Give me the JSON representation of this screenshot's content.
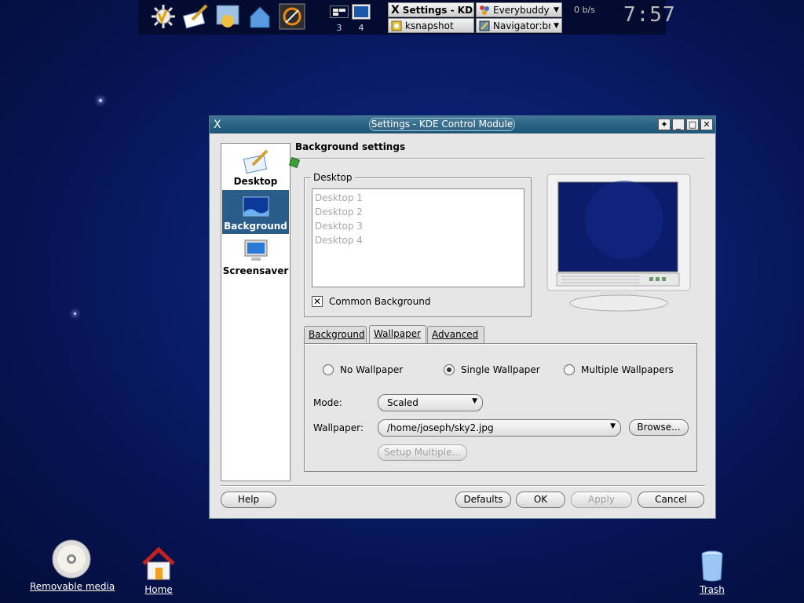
{
  "taskbar": {
    "pager": {
      "desk3": "3",
      "desk4": "4"
    },
    "tasks": [
      {
        "label": "Settings - KDE Control Module"
      },
      {
        "label": "Everybuddy"
      },
      {
        "label": "ksnapshot"
      },
      {
        "label": "Navigator:browser"
      }
    ],
    "net_speed": "0 b/s",
    "clock": "7:57"
  },
  "desktop_icons": {
    "removable": "Removable media",
    "home": "Home",
    "trash": "Trash"
  },
  "window": {
    "title": "Settings - KDE Control Module",
    "sidebar": {
      "items": [
        {
          "label": "Desktop"
        },
        {
          "label": "Background"
        },
        {
          "label": "Screensaver"
        }
      ]
    },
    "heading": "Background settings",
    "desktop_group": {
      "title": "Desktop",
      "items": [
        "Desktop 1",
        "Desktop 2",
        "Desktop 3",
        "Desktop 4"
      ],
      "common_background_label": "Common Background",
      "common_background_checked": true
    },
    "tabs": [
      "Background",
      "Wallpaper",
      "Advanced"
    ],
    "wallpaper": {
      "no_wallpaper": "No Wallpaper",
      "single_wallpaper": "Single Wallpaper",
      "multiple_wallpapers": "Multiple Wallpapers",
      "mode_label": "Mode:",
      "mode_value": "Scaled",
      "wallpaper_label": "Wallpaper:",
      "wallpaper_value": "/home/joseph/sky2.jpg",
      "browse": "Browse...",
      "setup_multiple": "Setup Multiple..."
    },
    "buttons": {
      "help": "Help",
      "defaults": "Defaults",
      "ok": "OK",
      "apply": "Apply",
      "cancel": "Cancel"
    }
  },
  "colors": {
    "selection": "#2a5c89",
    "titlebar": "#2a6283",
    "desktop": "#0a1f6e"
  }
}
